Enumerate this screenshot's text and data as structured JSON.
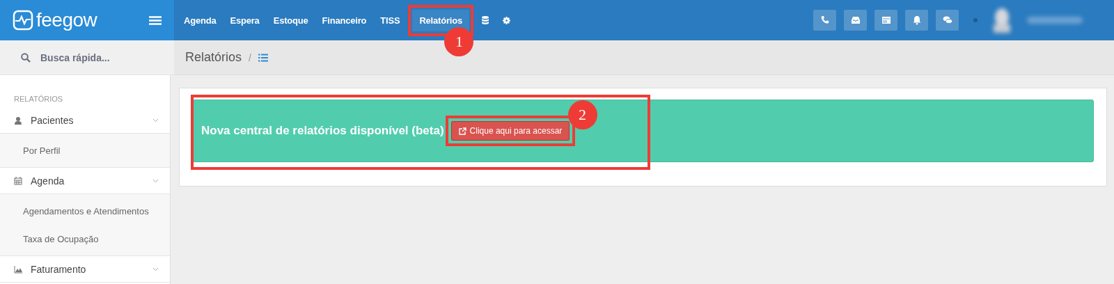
{
  "brand": {
    "name": "feegow"
  },
  "nav": [
    {
      "label": "Agenda",
      "selected": false
    },
    {
      "label": "Espera",
      "selected": false
    },
    {
      "label": "Estoque",
      "selected": false
    },
    {
      "label": "Financeiro",
      "selected": false
    },
    {
      "label": "TISS",
      "selected": false
    },
    {
      "label": "Relatórios",
      "selected": true
    }
  ],
  "search": {
    "placeholder": "Busca rápida..."
  },
  "breadcrumb": {
    "title": "Relatórios",
    "separator": "/"
  },
  "sidebar": {
    "section": "RELATÓRIOS",
    "items": [
      {
        "label": "Pacientes",
        "children": [
          {
            "label": "Por Perfil"
          }
        ]
      },
      {
        "label": "Agenda",
        "children": [
          {
            "label": "Agendamentos e Atendimentos"
          },
          {
            "label": "Taxa de Ocupação"
          }
        ]
      },
      {
        "label": "Faturamento"
      }
    ]
  },
  "banner": {
    "text": "Nova central de relatórios disponível (beta)",
    "button": "Clique aqui para acessar"
  },
  "annotations": [
    {
      "number": "1"
    },
    {
      "number": "2"
    }
  ]
}
